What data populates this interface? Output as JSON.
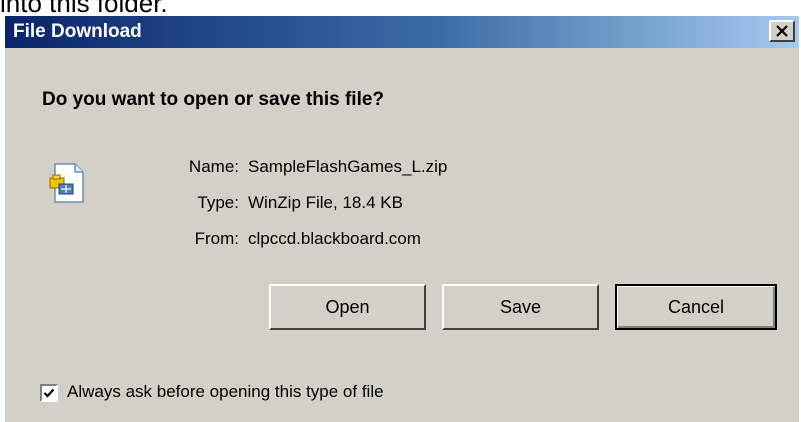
{
  "background_text": "into this folder.",
  "dialog": {
    "title": "File Download",
    "close_label": "X",
    "question": "Do you want to open or save this file?",
    "file_icon": "zip-file-icon",
    "fields": [
      {
        "label": "Name:",
        "value": "SampleFlashGames_L.zip"
      },
      {
        "label": "Type:",
        "value": "WinZip File, 18.4 KB"
      },
      {
        "label": "From:",
        "value": "clpccd.blackboard.com"
      }
    ],
    "buttons": {
      "open": "Open",
      "save": "Save",
      "cancel": "Cancel"
    },
    "checkbox": {
      "label": "Always ask before opening this type of file",
      "checked": true
    }
  },
  "colors": {
    "title_bar_start": "#0a246a",
    "title_bar_end": "#a6caf0",
    "dialog_face": "#d4d0c8"
  }
}
